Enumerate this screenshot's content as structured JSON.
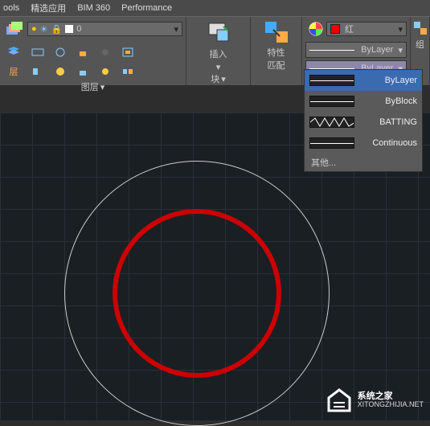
{
  "menu": {
    "tools": "ools",
    "featured": "精选应用",
    "bim": "BIM 360",
    "perf": "Performance"
  },
  "layers": {
    "title": "图层",
    "current": "0",
    "arrow": "▾"
  },
  "block": {
    "title": "块",
    "insert": "插入",
    "arrow": "▾"
  },
  "props": {
    "title": "特性\n匹配"
  },
  "color": {
    "label": "红",
    "bylayer": "ByLayer",
    "arrow": "▾"
  },
  "linetype": {
    "current": "ByLayer",
    "arrow": "▾"
  },
  "group": {
    "title": "组"
  },
  "dropdown": {
    "items": [
      {
        "label": "ByLayer",
        "type": "solid"
      },
      {
        "label": "ByBlock",
        "type": "solid"
      },
      {
        "label": "BATTING",
        "type": "zigzag"
      },
      {
        "label": "Continuous",
        "type": "solid"
      }
    ],
    "other": "其他..."
  },
  "watermark": {
    "title": "系统之家",
    "url": "XITONGZHIJIA.NET"
  }
}
